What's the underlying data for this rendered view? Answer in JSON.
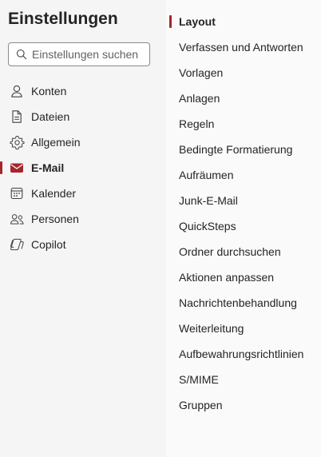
{
  "header": {
    "title": "Einstellungen"
  },
  "search": {
    "placeholder": "Einstellungen suchen"
  },
  "nav": {
    "items": [
      {
        "label": "Konten",
        "icon": "person-icon"
      },
      {
        "label": "Dateien",
        "icon": "document-icon"
      },
      {
        "label": "Allgemein",
        "icon": "gear-icon"
      },
      {
        "label": "E-Mail",
        "icon": "mail-icon",
        "active": true
      },
      {
        "label": "Kalender",
        "icon": "calendar-icon"
      },
      {
        "label": "Personen",
        "icon": "people-icon"
      },
      {
        "label": "Copilot",
        "icon": "copilot-icon"
      }
    ]
  },
  "submenu": {
    "items": [
      {
        "label": "Layout",
        "active": true
      },
      {
        "label": "Verfassen und Antworten"
      },
      {
        "label": "Vorlagen"
      },
      {
        "label": "Anlagen"
      },
      {
        "label": "Regeln"
      },
      {
        "label": "Bedingte Formatierung"
      },
      {
        "label": "Aufräumen"
      },
      {
        "label": "Junk-E-Mail"
      },
      {
        "label": "QuickSteps"
      },
      {
        "label": "Ordner durchsuchen"
      },
      {
        "label": "Aktionen anpassen"
      },
      {
        "label": "Nachrichtenbehandlung"
      },
      {
        "label": "Weiterleitung"
      },
      {
        "label": "Aufbewahrungsrichtlinien"
      },
      {
        "label": "S/MIME"
      },
      {
        "label": "Gruppen"
      }
    ]
  },
  "colors": {
    "accent": "#a4262c",
    "text": "#242424"
  }
}
